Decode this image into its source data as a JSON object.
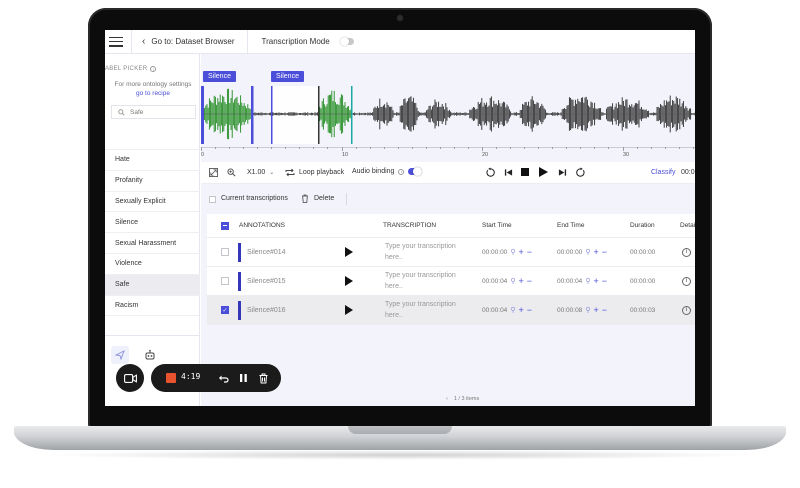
{
  "topbar": {
    "back_label": "Go to: Dataset Browser",
    "mode_label": "Transcription Mode"
  },
  "sidebar": {
    "title": "ABEL PICKER",
    "hint": "For more ontology settings",
    "link": "go to recipe",
    "search_value": "Safe",
    "labels": [
      {
        "label": "Hate"
      },
      {
        "label": "Profanity"
      },
      {
        "label": "Sexually Explicit"
      },
      {
        "label": "Silence"
      },
      {
        "label": "Sexual Harassment"
      },
      {
        "label": "Violence"
      },
      {
        "label": "Safe"
      },
      {
        "label": "Racism"
      }
    ]
  },
  "waveform": {
    "chips": [
      "Silence",
      "Silence"
    ],
    "ruler_ticks": [
      "0",
      "10",
      "20",
      "30"
    ],
    "colors": {
      "segment": "#1f8a1f",
      "wave": "#2a2a2a",
      "accent": "#4a4ed8",
      "cursor": "#1aa7a7"
    }
  },
  "controls": {
    "zoom": "X1.00",
    "loop": "Loop playback",
    "audio_binding": "Audio binding",
    "classify": "Classify",
    "time": "00:0"
  },
  "transcriptions": {
    "current_label": "Current transcriptions",
    "delete_label": "Delete",
    "headers": {
      "annotations": "ANNOTATIONS",
      "transcription": "TRANSCRIPTION",
      "start": "Start Time",
      "end": "End Time",
      "duration": "Duration",
      "details": "Detai"
    },
    "rows": [
      {
        "name": "Silence#014",
        "placeholder": "Type your transcription here...",
        "ph1": "Type your transcription",
        "ph2": "here..",
        "start": "00:00:00",
        "end": "00:00:00",
        "duration": "00:00:00",
        "checked": false
      },
      {
        "name": "Silence#015",
        "placeholder": "Type your transcription here...",
        "ph1": "Type your transcription",
        "ph2": "here..",
        "start": "00:00:04",
        "end": "00:00:04",
        "duration": "00:00:00",
        "checked": false
      },
      {
        "name": "Silence#016",
        "placeholder": "Type your transcription here...",
        "ph1": "Type your transcription",
        "ph2": "here..",
        "start": "00:00:04",
        "end": "00:00:08",
        "duration": "00:00:03",
        "checked": true
      }
    ],
    "pager": "1 / 3 items"
  },
  "recorder": {
    "time": "4:19"
  }
}
